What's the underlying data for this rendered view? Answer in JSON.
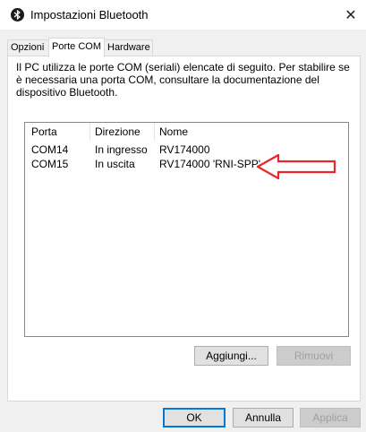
{
  "window": {
    "title": "Impostazioni Bluetooth",
    "close_glyph": "✕"
  },
  "tabs": [
    {
      "label": "Opzioni",
      "active": false
    },
    {
      "label": "Porte COM",
      "active": true
    },
    {
      "label": "Hardware",
      "active": false
    }
  ],
  "description": "Il PC utilizza le porte COM (seriali) elencate di seguito. Per stabilire se è necessaria una porta COM, consultare la documentazione del dispositivo Bluetooth.",
  "list": {
    "columns": [
      "Porta",
      "Direzione",
      "Nome"
    ],
    "rows": [
      {
        "porta": "COM14",
        "direzione": "In ingresso",
        "nome": "RV174000"
      },
      {
        "porta": "COM15",
        "direzione": "In uscita",
        "nome": "RV174000 'RNI-SPP'"
      }
    ]
  },
  "panel_buttons": {
    "add": "Aggiungi...",
    "remove": "Rimuovi"
  },
  "dialog_buttons": {
    "ok": "OK",
    "cancel": "Annulla",
    "apply": "Applica"
  },
  "colors": {
    "annotation_arrow": "#e8262b",
    "accent": "#0078d7"
  },
  "icons": {
    "title": "bluetooth-icon",
    "annotation": "red-arrow-annotation"
  }
}
